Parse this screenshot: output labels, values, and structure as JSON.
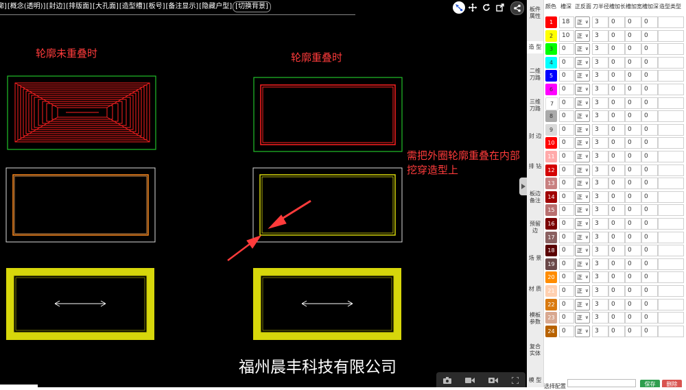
{
  "toolbar": {
    "buttons": [
      "[轮廓]",
      "[概念(透明)]",
      "[封边]",
      "[排版面]",
      "[大孔面]",
      "[造型槽]",
      "[板号]",
      "[备注显示]",
      "[隐藏户型]",
      "[切换背景]"
    ]
  },
  "top_icons": [
    "select-icon",
    "move-icon",
    "refresh-icon",
    "external-link-icon",
    "share-icon"
  ],
  "canvas": {
    "label_left": "轮廓未重叠时",
    "label_right": "轮廓重叠时",
    "note": "需把外圈轮廓重叠在内部挖穿造型上",
    "company": "福州晨丰科技有限公司"
  },
  "colors": {
    "canvas_bg": "#000000",
    "green_frame": "#22c02a",
    "red_shape": "#ff2020",
    "orange_shape": "#ff8a1e",
    "yellow_shape": "#d7d70b",
    "annotation_red": "#ff3b3b"
  },
  "side_tabs": [
    {
      "label": "板件属性"
    },
    {
      "label": "造 型"
    },
    {
      "label": "二维刀路"
    },
    {
      "label": "三维刀路"
    },
    {
      "label": "封 边"
    },
    {
      "label": "排 钻"
    },
    {
      "label": "板边备注"
    },
    {
      "label": "预留边"
    },
    {
      "label": "场 景"
    },
    {
      "label": "材 质"
    },
    {
      "label": "模板参数"
    },
    {
      "label": "复合实体"
    },
    {
      "label": "模 型"
    }
  ],
  "panel": {
    "headers": [
      "颜色",
      "槽深",
      "正反面",
      "刀半径",
      "槽加长",
      "槽加宽",
      "槽加深",
      "造型类型"
    ],
    "rows": [
      {
        "id": "1",
        "color": "#ff0000",
        "text_color": "#ffffff",
        "depth": "18",
        "side": "正",
        "radius": "3",
        "add_len": "0",
        "add_wid": "0",
        "add_dep": "0"
      },
      {
        "id": "2",
        "color": "#ffff00",
        "text_color": "#333333",
        "depth": "10",
        "side": "正",
        "radius": "3",
        "add_len": "0",
        "add_wid": "0",
        "add_dep": "0"
      },
      {
        "id": "3",
        "color": "#00ff00",
        "text_color": "#333333",
        "depth": "0",
        "side": "正",
        "radius": "3",
        "add_len": "0",
        "add_wid": "0",
        "add_dep": "0"
      },
      {
        "id": "4",
        "color": "#00ffff",
        "text_color": "#333333",
        "depth": "0",
        "side": "正",
        "radius": "3",
        "add_len": "0",
        "add_wid": "0",
        "add_dep": "0"
      },
      {
        "id": "5",
        "color": "#0000ff",
        "text_color": "#ffffff",
        "depth": "0",
        "side": "正",
        "radius": "3",
        "add_len": "0",
        "add_wid": "0",
        "add_dep": "0"
      },
      {
        "id": "6",
        "color": "#ff00ff",
        "text_color": "#333333",
        "depth": "0",
        "side": "正",
        "radius": "3",
        "add_len": "0",
        "add_wid": "0",
        "add_dep": "0"
      },
      {
        "id": "7",
        "color": "#ffffff",
        "text_color": "#333333",
        "depth": "0",
        "side": "正",
        "radius": "3",
        "add_len": "0",
        "add_wid": "0",
        "add_dep": "0"
      },
      {
        "id": "8",
        "color": "#aaaaaa",
        "text_color": "#333333",
        "depth": "0",
        "side": "正",
        "radius": "3",
        "add_len": "0",
        "add_wid": "0",
        "add_dep": "0"
      },
      {
        "id": "9",
        "color": "#d9d9d9",
        "text_color": "#333333",
        "depth": "0",
        "side": "正",
        "radius": "3",
        "add_len": "0",
        "add_wid": "0",
        "add_dep": "0"
      },
      {
        "id": "10",
        "color": "#ff0000",
        "text_color": "#ffffff",
        "depth": "0",
        "side": "正",
        "radius": "3",
        "add_len": "0",
        "add_wid": "0",
        "add_dep": "0"
      },
      {
        "id": "11",
        "color": "#ffaaaa",
        "text_color": "#ffffff",
        "depth": "0",
        "side": "正",
        "radius": "3",
        "add_len": "0",
        "add_wid": "0",
        "add_dep": "0"
      },
      {
        "id": "12",
        "color": "#d40000",
        "text_color": "#ffffff",
        "depth": "0",
        "side": "正",
        "radius": "3",
        "add_len": "0",
        "add_wid": "0",
        "add_dep": "0"
      },
      {
        "id": "13",
        "color": "#c88080",
        "text_color": "#ffffff",
        "depth": "0",
        "side": "正",
        "radius": "3",
        "add_len": "0",
        "add_wid": "0",
        "add_dep": "0"
      },
      {
        "id": "14",
        "color": "#a00000",
        "text_color": "#ffffff",
        "depth": "0",
        "side": "正",
        "radius": "3",
        "add_len": "0",
        "add_wid": "0",
        "add_dep": "0"
      },
      {
        "id": "15",
        "color": "#b97070",
        "text_color": "#ffffff",
        "depth": "0",
        "side": "正",
        "radius": "3",
        "add_len": "0",
        "add_wid": "0",
        "add_dep": "0"
      },
      {
        "id": "16",
        "color": "#7a0000",
        "text_color": "#ffffff",
        "depth": "0",
        "side": "正",
        "radius": "3",
        "add_len": "0",
        "add_wid": "0",
        "add_dep": "0"
      },
      {
        "id": "17",
        "color": "#8a6060",
        "text_color": "#ffffff",
        "depth": "0",
        "side": "正",
        "radius": "3",
        "add_len": "0",
        "add_wid": "0",
        "add_dep": "0"
      },
      {
        "id": "18",
        "color": "#5a0000",
        "text_color": "#ffffff",
        "depth": "0",
        "side": "正",
        "radius": "3",
        "add_len": "0",
        "add_wid": "0",
        "add_dep": "0"
      },
      {
        "id": "19",
        "color": "#6a4848",
        "text_color": "#ffffff",
        "depth": "0",
        "side": "正",
        "radius": "3",
        "add_len": "0",
        "add_wid": "0",
        "add_dep": "0"
      },
      {
        "id": "20",
        "color": "#ff8c00",
        "text_color": "#ffffff",
        "depth": "0",
        "side": "正",
        "radius": "3",
        "add_len": "0",
        "add_wid": "0",
        "add_dep": "0"
      },
      {
        "id": "21",
        "color": "#ffd0b0",
        "text_color": "#ffffff",
        "depth": "0",
        "side": "正",
        "radius": "3",
        "add_len": "0",
        "add_wid": "0",
        "add_dep": "0"
      },
      {
        "id": "22",
        "color": "#d97a10",
        "text_color": "#ffffff",
        "depth": "0",
        "side": "正",
        "radius": "3",
        "add_len": "0",
        "add_wid": "0",
        "add_dep": "0"
      },
      {
        "id": "23",
        "color": "#d8a890",
        "text_color": "#ffffff",
        "depth": "0",
        "side": "正",
        "radius": "3",
        "add_len": "0",
        "add_wid": "0",
        "add_dep": "0"
      },
      {
        "id": "24",
        "color": "#b86200",
        "text_color": "#ffffff",
        "depth": "0",
        "side": "正",
        "radius": "3",
        "add_len": "0",
        "add_wid": "0",
        "add_dep": "0"
      }
    ],
    "footer": {
      "scheme_label": "选择配置",
      "scheme_value": "",
      "save_label": "保存",
      "delete_label": "删除"
    }
  },
  "view_icons": [
    "camera-icon",
    "video-icon",
    "video-record-icon",
    "fullscreen-icon"
  ]
}
